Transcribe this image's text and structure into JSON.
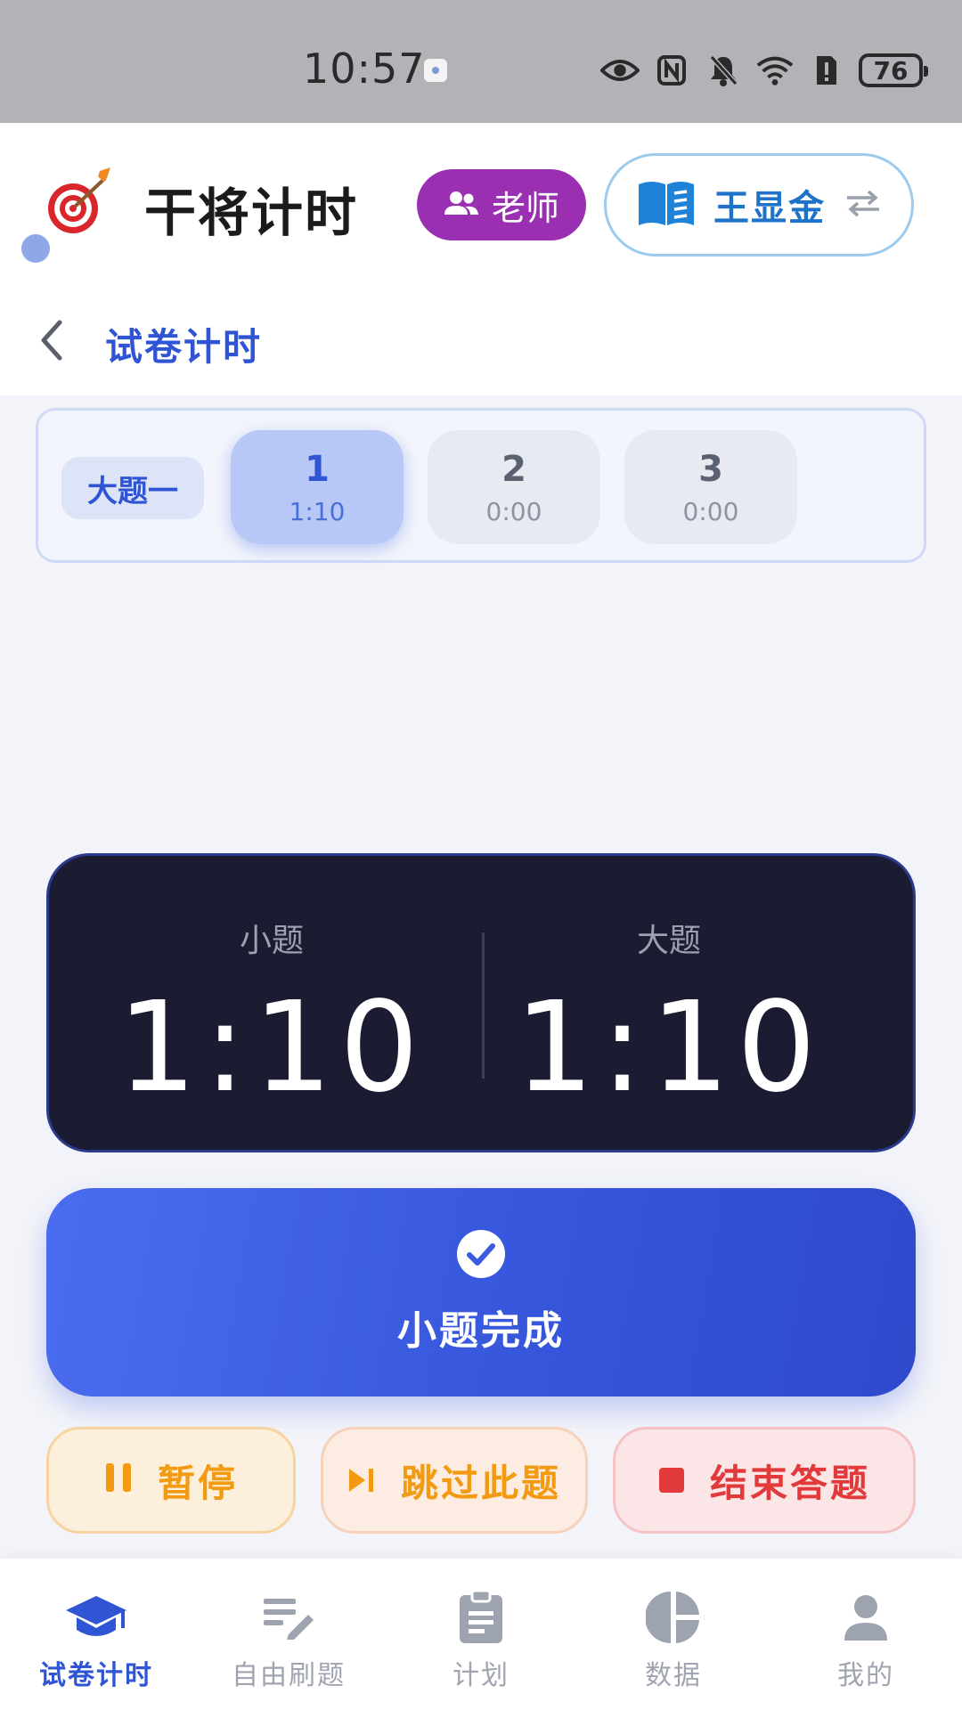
{
  "status_bar": {
    "time": "10:57",
    "battery": "76"
  },
  "header": {
    "app_title": "干将计时",
    "role_label": "老师",
    "user_name": "王显金"
  },
  "nav": {
    "title": "试卷计时"
  },
  "question_strip": {
    "section_label": "大题一",
    "questions": [
      {
        "number": "1",
        "time": "1:10",
        "active": true
      },
      {
        "number": "2",
        "time": "0:00",
        "active": false
      },
      {
        "number": "3",
        "time": "0:00",
        "active": false
      }
    ]
  },
  "timer": {
    "sub_label": "小题",
    "sub_value": "1:10",
    "main_label": "大题",
    "main_value": "1:10"
  },
  "actions": {
    "complete_label": "小题完成",
    "pause_label": "暂停",
    "skip_label": "跳过此题",
    "end_label": "结束答题"
  },
  "colors": {
    "primary": "#2f55d4",
    "role_pill": "#9a2fb2",
    "timer_bg": "#1b1c31",
    "pause": "#f29a12",
    "end": "#e23a3a"
  },
  "tabs": [
    {
      "label": "试卷计时",
      "icon": "graduation-cap-icon",
      "active": true
    },
    {
      "label": "自由刷题",
      "icon": "edit-notes-icon",
      "active": false
    },
    {
      "label": "计划",
      "icon": "clipboard-icon",
      "active": false
    },
    {
      "label": "数据",
      "icon": "pie-chart-icon",
      "active": false
    },
    {
      "label": "我的",
      "icon": "person-icon",
      "active": false
    }
  ]
}
